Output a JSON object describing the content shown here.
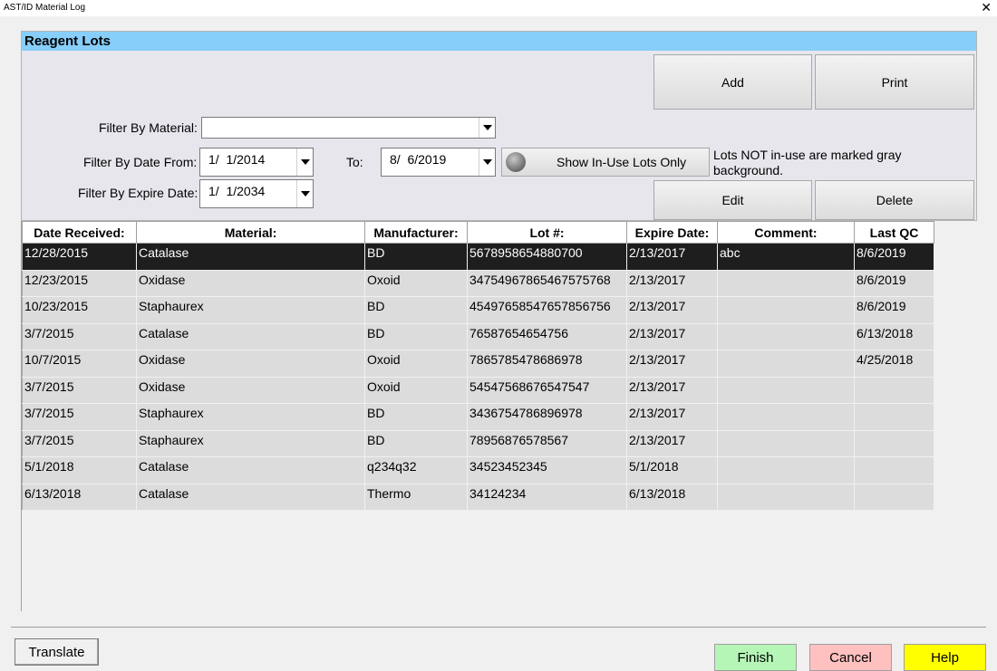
{
  "window": {
    "title": "AST/ID Material Log",
    "close_glyph": "✕"
  },
  "panel": {
    "title": "Reagent Lots"
  },
  "buttons": {
    "add": "Add",
    "print": "Print",
    "edit": "Edit",
    "delete": "Delete",
    "show_in_use": "Show In-Use Lots Only"
  },
  "filters": {
    "material_label": "Filter By Material:",
    "material_value": "",
    "date_from_label": "Filter By Date From:",
    "date_from_value": "1/  1/2014",
    "to_label": "To:",
    "to_value": "8/  6/2019",
    "expire_label": "Filter By Expire Date:",
    "expire_value": "1/  1/2034"
  },
  "note": "Lots NOT in-use are marked gray background.",
  "table": {
    "columns": [
      "Date Received:",
      "Material:",
      "Manufacturer:",
      "Lot #:",
      "Expire Date:",
      "Comment:",
      "Last QC"
    ],
    "rows": [
      [
        "12/28/2015",
        "Catalase",
        "BD",
        "5678958654880700",
        "2/13/2017",
        "abc",
        "8/6/2019"
      ],
      [
        "12/23/2015",
        "Oxidase",
        "Oxoid",
        "34754967865467575768",
        "2/13/2017",
        "",
        "8/6/2019"
      ],
      [
        "10/23/2015",
        "Staphaurex",
        "BD",
        "45497658547657856756",
        "2/13/2017",
        "",
        "8/6/2019"
      ],
      [
        "3/7/2015",
        "Catalase",
        "BD",
        "76587654654756",
        "2/13/2017",
        "",
        "6/13/2018"
      ],
      [
        "10/7/2015",
        "Oxidase",
        "Oxoid",
        "7865785478686978",
        "2/13/2017",
        "",
        "4/25/2018"
      ],
      [
        "3/7/2015",
        "Oxidase",
        "Oxoid",
        "54547568676547547",
        "2/13/2017",
        "",
        ""
      ],
      [
        "3/7/2015",
        "Staphaurex",
        "BD",
        "3436754786896978",
        "2/13/2017",
        "",
        ""
      ],
      [
        "3/7/2015",
        "Staphaurex",
        "BD",
        "78956876578567",
        "2/13/2017",
        "",
        ""
      ],
      [
        "5/1/2018",
        "Catalase",
        "q234q32",
        "34523452345",
        "5/1/2018",
        "",
        ""
      ],
      [
        "6/13/2018",
        "Catalase",
        "Thermo",
        "34124234",
        "6/13/2018",
        "",
        ""
      ]
    ],
    "selected_row": 0
  },
  "footer": {
    "translate": "Translate",
    "finish": "Finish",
    "cancel": "Cancel",
    "help": "Help"
  },
  "colors": {
    "header": "#87cefa",
    "finish": "#b5f5b5",
    "cancel": "#ffc0c0",
    "help": "#ffff00",
    "selected": "#1e1e1e",
    "inactive_row": "#dcdcdc"
  }
}
